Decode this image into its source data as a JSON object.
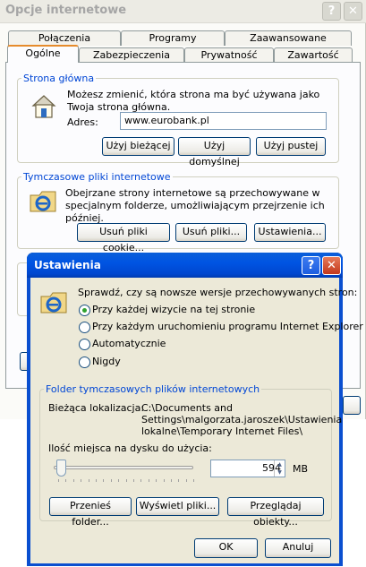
{
  "bg_window": {
    "title": "Opcje internetowe",
    "tabs_row1": [
      "Połączenia",
      "Programy",
      "Zaawansowane"
    ],
    "tabs_row2": [
      "Ogólne",
      "Zabezpieczenia",
      "Prywatność",
      "Zawartość"
    ],
    "home": {
      "legend": "Strona główna",
      "desc": "Możesz zmienić, która strona ma być używana jako Twoja strona główna.",
      "address_label": "Adres:",
      "address_value": "www.eurobank.pl",
      "btn_current": "Użyj bieżącej",
      "btn_default": "Użyj domyślnej",
      "btn_blank": "Użyj pustej"
    },
    "temp": {
      "legend": "Tymczasowe pliki internetowe",
      "desc": "Obejrzane strony internetowe są przechowywane w specjalnym folderze, umożliwiającym przejrzenie ich później.",
      "btn_cookies": "Usuń pliki cookie...",
      "btn_files": "Usuń pliki...",
      "btn_settings": "Ustawienia..."
    }
  },
  "dialog": {
    "title": "Ustawienia",
    "check_question": "Sprawdź, czy są nowsze wersje przechowywanych stron:",
    "options": [
      {
        "label": "Przy każdej wizycie na tej stronie",
        "selected": true
      },
      {
        "label": "Przy każdym uruchomieniu programu Internet Explorer",
        "selected": false
      },
      {
        "label": "Automatycznie",
        "selected": false
      },
      {
        "label": "Nigdy",
        "selected": false
      }
    ],
    "folder": {
      "legend": "Folder tymczasowych plików internetowych",
      "location_label": "Bieżąca lokalizacja:",
      "location_line1": "C:\\Documents and",
      "location_line2": "Settings\\malgorzata.jaroszek\\Ustawienia",
      "location_line3": "lokalne\\Temporary Internet Files\\",
      "space_label": "Ilość miejsca na dysku do użycia:",
      "space_value": "594",
      "space_unit": "MB",
      "slider_fraction": 0.02,
      "btn_move": "Przenieś folder...",
      "btn_view_files": "Wyświetl pliki...",
      "btn_view_objects": "Przeglądaj obiekty..."
    },
    "btn_ok": "OK",
    "btn_cancel": "Anuluj"
  },
  "icons": {
    "home": "house-icon",
    "temp": "ie-folder-icon",
    "dialog": "ie-folder-icon"
  }
}
